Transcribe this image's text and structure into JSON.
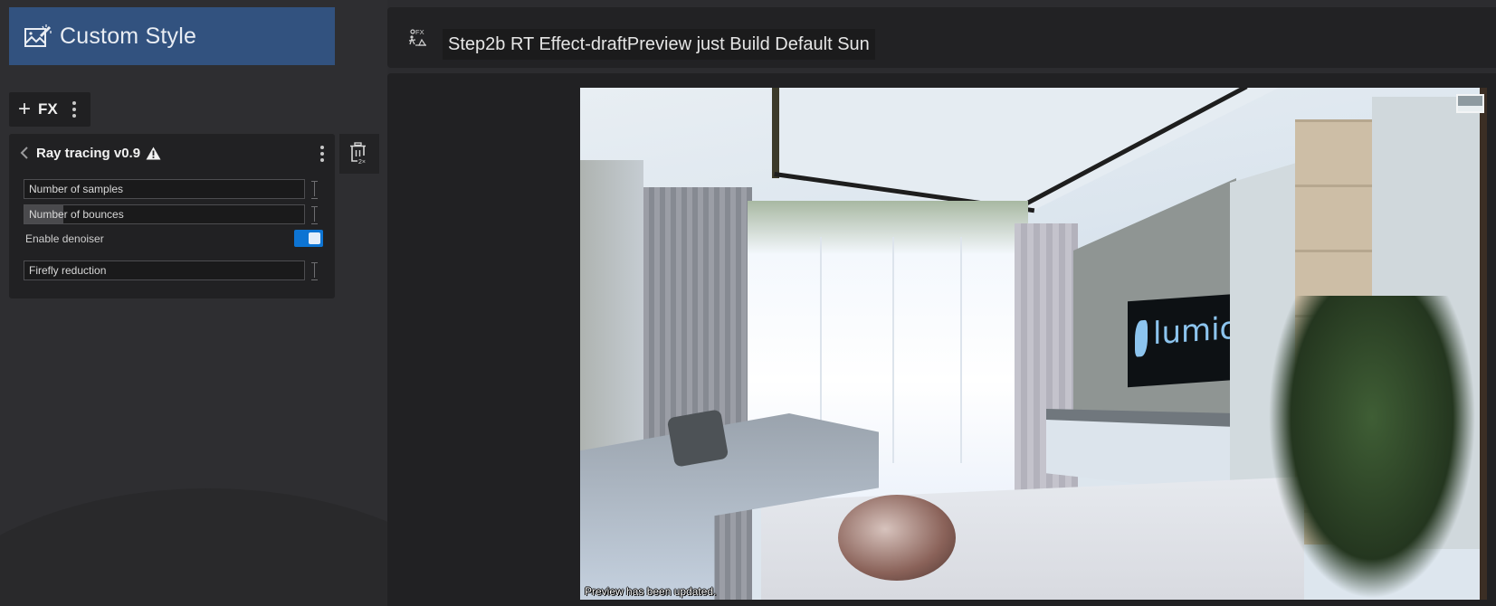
{
  "sidebar": {
    "title": "Custom Style",
    "title_icon": "image-sparkle-icon",
    "fx_toolbar": {
      "add_label": "FX",
      "add_icon": "plus-icon",
      "more_icon": "vertical-ellipsis-icon"
    },
    "effect": {
      "title": "Ray tracing v0.9",
      "back_icon": "chevron-left-icon",
      "warning_icon": "warning-triangle-icon",
      "more_icon": "vertical-ellipsis-icon",
      "params": [
        {
          "label": "Number of samples",
          "type": "slider",
          "fill_fraction": 0.0
        },
        {
          "label": "Number of bounces",
          "type": "slider",
          "fill_fraction": 0.14
        },
        {
          "label": "Enable denoiser",
          "type": "toggle",
          "value": true
        },
        {
          "label": "Firefly reduction",
          "type": "slider",
          "fill_fraction": 0.0
        }
      ]
    },
    "delete_panel": {
      "icon": "trash-icon",
      "badge": "2×"
    }
  },
  "header": {
    "icon": "fx-effects-icon",
    "project_name": "Step2b RT Effect-draftPreview just Build Default Sun"
  },
  "preview": {
    "status": "Preview has been updated.",
    "view_toggle_icon": "view-mode-icon",
    "scene_text": "lumion"
  },
  "colors": {
    "accent": "#0d74d3",
    "title_banner": "#32527f",
    "background": "#2c2c2f",
    "panel": "#212123"
  }
}
